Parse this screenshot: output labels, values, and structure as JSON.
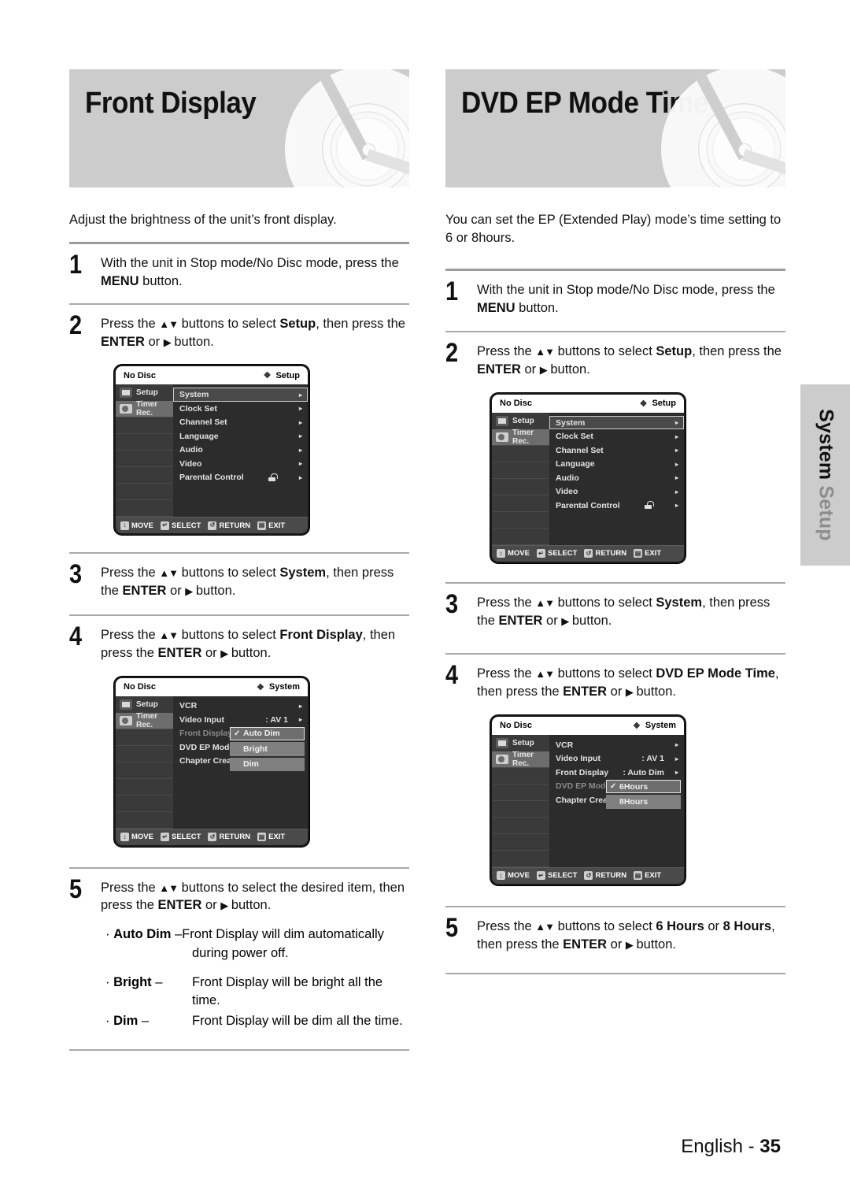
{
  "side_tab": {
    "line_a": "System",
    "line_b": " Setup"
  },
  "footer": {
    "language": "English",
    "sep": " - ",
    "page": "35"
  },
  "left": {
    "title": "Front Display",
    "intro": "Adjust the brightness of the unit’s front display.",
    "steps": [
      {
        "num": "1",
        "html": "With the unit in Stop mode/No Disc mode, press the <b>MENU</b> button."
      },
      {
        "num": "2",
        "html": "Press the <span class=\"arrow\">▲▼</span> buttons to select <b>Setup</b>, then press the <b>ENTER</b> or <span class=\"arrow\">▶</span> button."
      },
      {
        "num": "3",
        "html": "Press the <span class=\"arrow\">▲▼</span> buttons to select <b>System</b>, then press the <b>ENTER</b> or <span class=\"arrow\">▶</span> button."
      },
      {
        "num": "4",
        "html": "Press the <span class=\"arrow\">▲▼</span> buttons to select <b>Front Display</b>, then press the <b>ENTER</b> or <span class=\"arrow\">▶</span> button."
      },
      {
        "num": "5",
        "html": "Press the <span class=\"arrow\">▲▼</span> buttons to select the desired item, then press the <b>ENTER</b> or <span class=\"arrow\">▶</span> button."
      }
    ],
    "bullets": [
      {
        "term": "· Auto Dim – ",
        "desc": "Front Display will dim automatically",
        "desc2": "during power off."
      },
      {
        "term": "· Bright – ",
        "desc": "Front Display will be bright all the",
        "desc2": "time."
      },
      {
        "term": "· Dim – ",
        "desc": "Front Display will be dim all the time.",
        "desc2": ""
      }
    ],
    "osd1": {
      "disc_status": "No Disc",
      "menu_name": "Setup",
      "side": [
        {
          "label": "Setup",
          "icon": "gear-icon"
        },
        {
          "label": "Timer Rec.",
          "icon": "timer-icon"
        }
      ],
      "rows": [
        {
          "label": "System",
          "value": "",
          "chev": "▸",
          "highlight": true
        },
        {
          "label": "Clock Set",
          "value": "",
          "chev": "▸",
          "highlight": false
        },
        {
          "label": "Channel Set",
          "value": "",
          "chev": "▸",
          "highlight": false
        },
        {
          "label": "Language",
          "value": "",
          "chev": "▸",
          "highlight": false
        },
        {
          "label": "Audio",
          "value": "",
          "chev": "▸",
          "highlight": false
        },
        {
          "label": "Video",
          "value": "",
          "chev": "▸",
          "highlight": false
        },
        {
          "label": "Parental Control",
          "value": "",
          "chev": "▸",
          "highlight": false,
          "lock": true
        }
      ],
      "bottom": [
        {
          "icon": "↕",
          "label": "MOVE"
        },
        {
          "icon": "↵",
          "label": "SELECT"
        },
        {
          "icon": "↺",
          "label": "RETURN"
        },
        {
          "icon": "▤",
          "label": "EXIT"
        }
      ]
    },
    "osd2": {
      "disc_status": "No Disc",
      "menu_name": "System",
      "side": [
        {
          "label": "Setup",
          "icon": "gear-icon"
        },
        {
          "label": "Timer Rec.",
          "icon": "timer-icon"
        }
      ],
      "rows": [
        {
          "label": "VCR",
          "value": "",
          "chev": "▸",
          "dimmed": false
        },
        {
          "label": "Video Input",
          "value": ": AV 1",
          "chev": "▸",
          "dimmed": false
        },
        {
          "label": "Front Display",
          "value": "",
          "chev": "",
          "dimmed": true
        },
        {
          "label": "DVD EP Mode Time",
          "value": "",
          "chev": "",
          "dimmed": false
        },
        {
          "label": "Chapter Creator",
          "value": "",
          "chev": "",
          "dimmed": false
        }
      ],
      "dropdown": {
        "options": [
          "Auto Dim",
          "Bright",
          "Dim"
        ],
        "selected_index": 0,
        "check": "✓"
      },
      "bottom": [
        {
          "icon": "↕",
          "label": "MOVE"
        },
        {
          "icon": "↵",
          "label": "SELECT"
        },
        {
          "icon": "↺",
          "label": "RETURN"
        },
        {
          "icon": "▤",
          "label": "EXIT"
        }
      ]
    }
  },
  "right": {
    "title": "DVD EP Mode Time",
    "intro": "You can set the EP (Extended Play) mode’s time setting to 6 or 8hours.",
    "steps": [
      {
        "num": "1",
        "html": "With the unit in Stop mode/No Disc mode, press the <b>MENU</b> button."
      },
      {
        "num": "2",
        "html": "Press the <span class=\"arrow\">▲▼</span> buttons to select <b>Setup</b>, then press the <b>ENTER</b> or <span class=\"arrow\">▶</span> button."
      },
      {
        "num": "3",
        "html": "Press the <span class=\"arrow\">▲▼</span> buttons to select <b>System</b>, then press the <b>ENTER</b> or <span class=\"arrow\">▶</span> button."
      },
      {
        "num": "4",
        "html": "Press the <span class=\"arrow\">▲▼</span> buttons to select <b>DVD EP Mode Time</b>, then press the <b>ENTER</b> or <span class=\"arrow\">▶</span> button."
      },
      {
        "num": "5",
        "html": "Press the <span class=\"arrow\">▲▼</span> buttons to select <b>6 Hours</b> or <b>8 Hours</b>, then press the <b>ENTER</b> or <span class=\"arrow\">▶</span> button."
      }
    ],
    "osd1": {
      "disc_status": "No Disc",
      "menu_name": "Setup",
      "side": [
        {
          "label": "Setup",
          "icon": "gear-icon"
        },
        {
          "label": "Timer Rec.",
          "icon": "timer-icon"
        }
      ],
      "rows": [
        {
          "label": "System",
          "value": "",
          "chev": "▸",
          "highlight": true
        },
        {
          "label": "Clock Set",
          "value": "",
          "chev": "▸",
          "highlight": false
        },
        {
          "label": "Channel Set",
          "value": "",
          "chev": "▸",
          "highlight": false
        },
        {
          "label": "Language",
          "value": "",
          "chev": "▸",
          "highlight": false
        },
        {
          "label": "Audio",
          "value": "",
          "chev": "▸",
          "highlight": false
        },
        {
          "label": "Video",
          "value": "",
          "chev": "▸",
          "highlight": false
        },
        {
          "label": "Parental Control",
          "value": "",
          "chev": "▸",
          "highlight": false,
          "lock": true
        }
      ],
      "bottom": [
        {
          "icon": "↕",
          "label": "MOVE"
        },
        {
          "icon": "↵",
          "label": "SELECT"
        },
        {
          "icon": "↺",
          "label": "RETURN"
        },
        {
          "icon": "▤",
          "label": "EXIT"
        }
      ]
    },
    "osd2": {
      "disc_status": "No Disc",
      "menu_name": "System",
      "side": [
        {
          "label": "Setup",
          "icon": "gear-icon"
        },
        {
          "label": "Timer Rec.",
          "icon": "timer-icon"
        }
      ],
      "rows": [
        {
          "label": "VCR",
          "value": "",
          "chev": "▸",
          "dimmed": false
        },
        {
          "label": "Video Input",
          "value": ": AV 1",
          "chev": "▸",
          "dimmed": false
        },
        {
          "label": "Front Display",
          "value": ": Auto Dim",
          "chev": "▸",
          "dimmed": false
        },
        {
          "label": "DVD EP Mode Time",
          "value": "",
          "chev": "",
          "dimmed": true
        },
        {
          "label": "Chapter Creator",
          "value": "",
          "chev": "",
          "dimmed": false
        }
      ],
      "dropdown": {
        "options": [
          "6Hours",
          "8Hours"
        ],
        "selected_index": 0,
        "check": "✓"
      },
      "bottom": [
        {
          "icon": "↕",
          "label": "MOVE"
        },
        {
          "icon": "↵",
          "label": "SELECT"
        },
        {
          "icon": "↺",
          "label": "RETURN"
        },
        {
          "icon": "▤",
          "label": "EXIT"
        }
      ]
    }
  },
  "colors": {
    "banner_bg": "#cccccc",
    "rule": "#9c9c9c",
    "osd_bg": "#2c2c2c",
    "osd_highlight": "#6e6e6e"
  }
}
